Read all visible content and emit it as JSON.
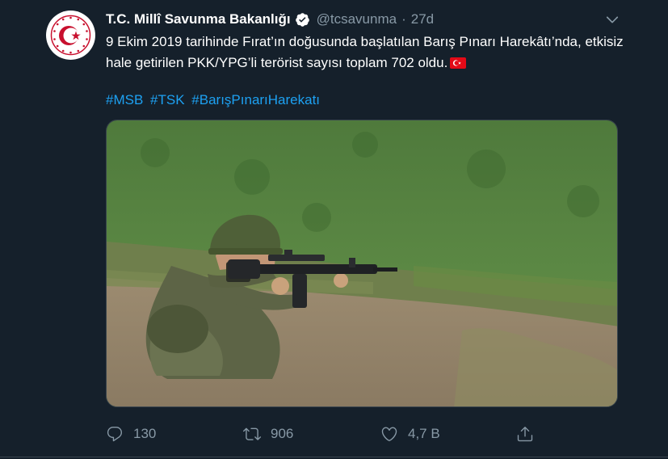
{
  "author": {
    "name": "T.C. Millî Savunma Bakanlığı",
    "handle": "@tcsavunma",
    "separator": "·",
    "time": "27d"
  },
  "tweet": {
    "text": "9 Ekim 2019 tarihinde Fırat’ın doğusunda başlatılan Barış Pınarı Harekâtı’nda, etkisiz hale getirilen PKK/YPG’li terörist sayısı toplam 702 oldu.",
    "hashtags": [
      "#MSB",
      "#TSK",
      "#BarışPınarıHarekatı"
    ]
  },
  "actions": {
    "replies": "130",
    "retweets": "906",
    "likes": "4,7 B"
  },
  "icons": {
    "reply": "reply-icon",
    "retweet": "retweet-icon",
    "like": "heart-icon",
    "share": "share-icon",
    "menu": "chevron-down-icon",
    "verified": "verified-badge-icon",
    "flag": "turkey-flag-icon"
  },
  "colors": {
    "background": "#15202b",
    "secondary_text": "#8899a6",
    "link": "#1da1f2",
    "verified": "#ffffff",
    "flag": "#e30a17"
  }
}
